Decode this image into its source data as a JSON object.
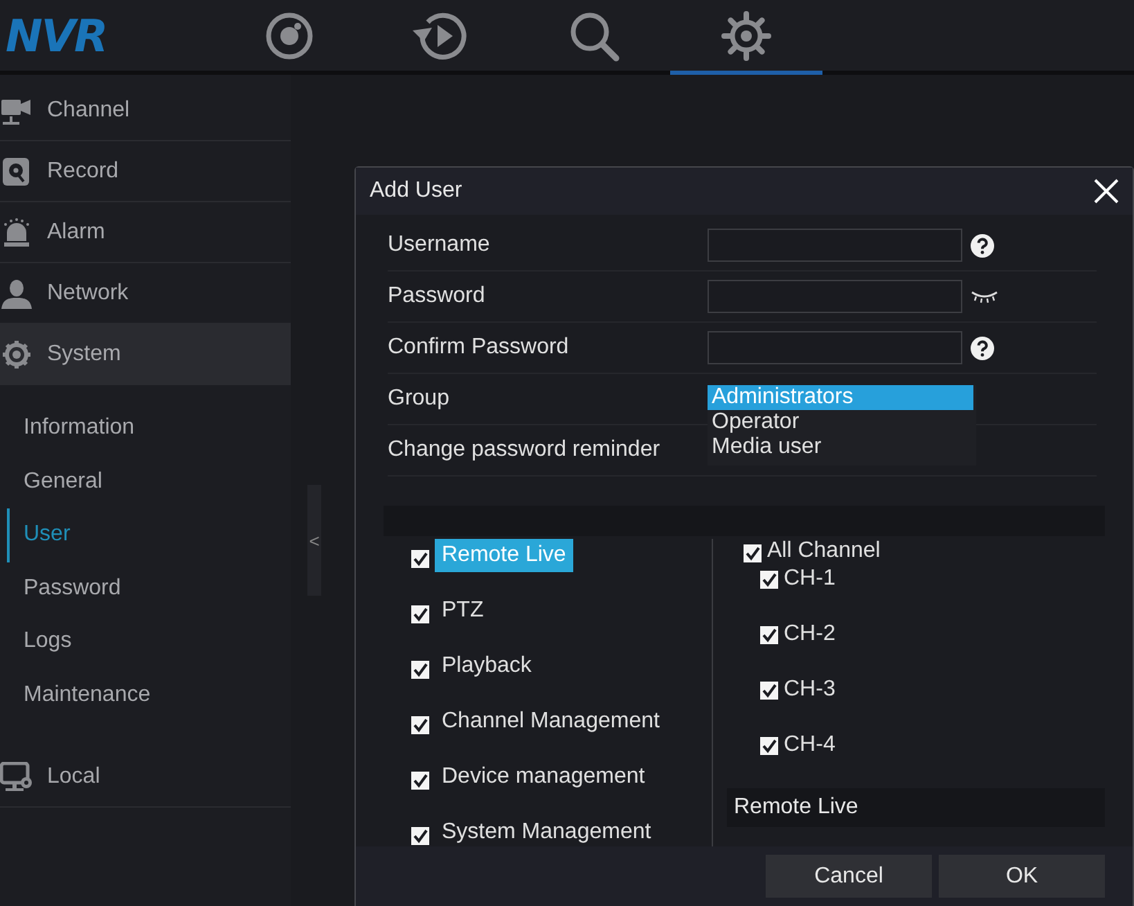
{
  "logo": "NVR",
  "top_tabs": [
    {
      "kind": "live",
      "selected": false
    },
    {
      "kind": "playback",
      "selected": false
    },
    {
      "kind": "search",
      "selected": false
    },
    {
      "kind": "settings",
      "selected": true
    }
  ],
  "sidebar": {
    "items": [
      {
        "label": "Channel",
        "kind": "channel",
        "expanded": false
      },
      {
        "label": "Record",
        "kind": "record",
        "expanded": false
      },
      {
        "label": "Alarm",
        "kind": "alarm",
        "expanded": false
      },
      {
        "label": "Network",
        "kind": "network",
        "expanded": false
      },
      {
        "label": "System",
        "kind": "system",
        "expanded": true,
        "children": [
          {
            "label": "Information",
            "selected": false
          },
          {
            "label": "General",
            "selected": false
          },
          {
            "label": "User",
            "selected": true
          },
          {
            "label": "Password",
            "selected": false
          },
          {
            "label": "Logs",
            "selected": false
          },
          {
            "label": "Maintenance",
            "selected": false
          }
        ]
      },
      {
        "label": "Local",
        "kind": "local",
        "expanded": false
      }
    ]
  },
  "collapse_handle": "<",
  "dialog": {
    "title": "Add User",
    "fields": [
      {
        "label": "Username",
        "kind": "help"
      },
      {
        "label": "Password",
        "kind": "reveal"
      },
      {
        "label": "Confirm Password",
        "kind": "help"
      }
    ],
    "group": {
      "label": "Group",
      "options": [
        {
          "label": "Administrators",
          "selected": true
        },
        {
          "label": "Operator",
          "selected": false
        },
        {
          "label": "Media user",
          "selected": false
        }
      ]
    },
    "reminder": {
      "label": "Change password reminder"
    },
    "permissions": [
      {
        "label": "Remote Live",
        "checked": true,
        "selected": true
      },
      {
        "label": "PTZ",
        "checked": true,
        "selected": false
      },
      {
        "label": "Playback",
        "checked": true,
        "selected": false
      },
      {
        "label": "Channel Management",
        "checked": true,
        "selected": false
      },
      {
        "label": "Device management",
        "checked": true,
        "selected": false
      },
      {
        "label": "System Management",
        "checked": true,
        "selected": false
      }
    ],
    "all_channel": {
      "label": "All Channel",
      "checked": true
    },
    "channels": [
      {
        "label": "CH-1",
        "checked": true
      },
      {
        "label": "CH-2",
        "checked": true
      },
      {
        "label": "CH-3",
        "checked": true
      },
      {
        "label": "CH-4",
        "checked": true
      }
    ],
    "selected_permission": "Remote Live",
    "buttons": [
      {
        "label": "Cancel"
      },
      {
        "label": "OK"
      }
    ]
  }
}
